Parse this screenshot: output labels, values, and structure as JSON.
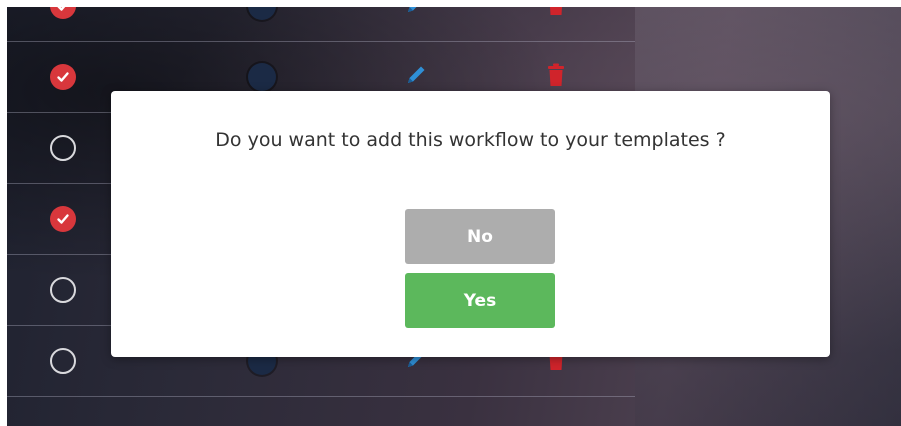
{
  "colors": {
    "check_on": "#d8373c",
    "dot": "#1b2a45",
    "edit_icon": "#2f8fd6",
    "delete_icon": "#d0242b",
    "button_no": "#adadad",
    "button_yes": "#5cb85c"
  },
  "rows": [
    {
      "checked": true,
      "color_dot": "dot",
      "edit_icon": "pencil-icon",
      "delete_icon": "trash-icon"
    },
    {
      "checked": true,
      "color_dot": "dot",
      "edit_icon": "pencil-icon",
      "delete_icon": "trash-icon"
    },
    {
      "checked": false,
      "color_dot": "dot",
      "edit_icon": "pencil-icon",
      "delete_icon": "trash-icon"
    },
    {
      "checked": true,
      "color_dot": "dot",
      "edit_icon": "pencil-icon",
      "delete_icon": "trash-icon"
    },
    {
      "checked": false,
      "color_dot": "dot",
      "edit_icon": "pencil-icon",
      "delete_icon": "trash-icon"
    },
    {
      "checked": false,
      "color_dot": "dot",
      "edit_icon": "pencil-icon",
      "delete_icon": "trash-icon"
    }
  ],
  "dialog": {
    "message": "Do you want to add this workflow to your templates ?",
    "no_label": "No",
    "yes_label": "Yes"
  }
}
